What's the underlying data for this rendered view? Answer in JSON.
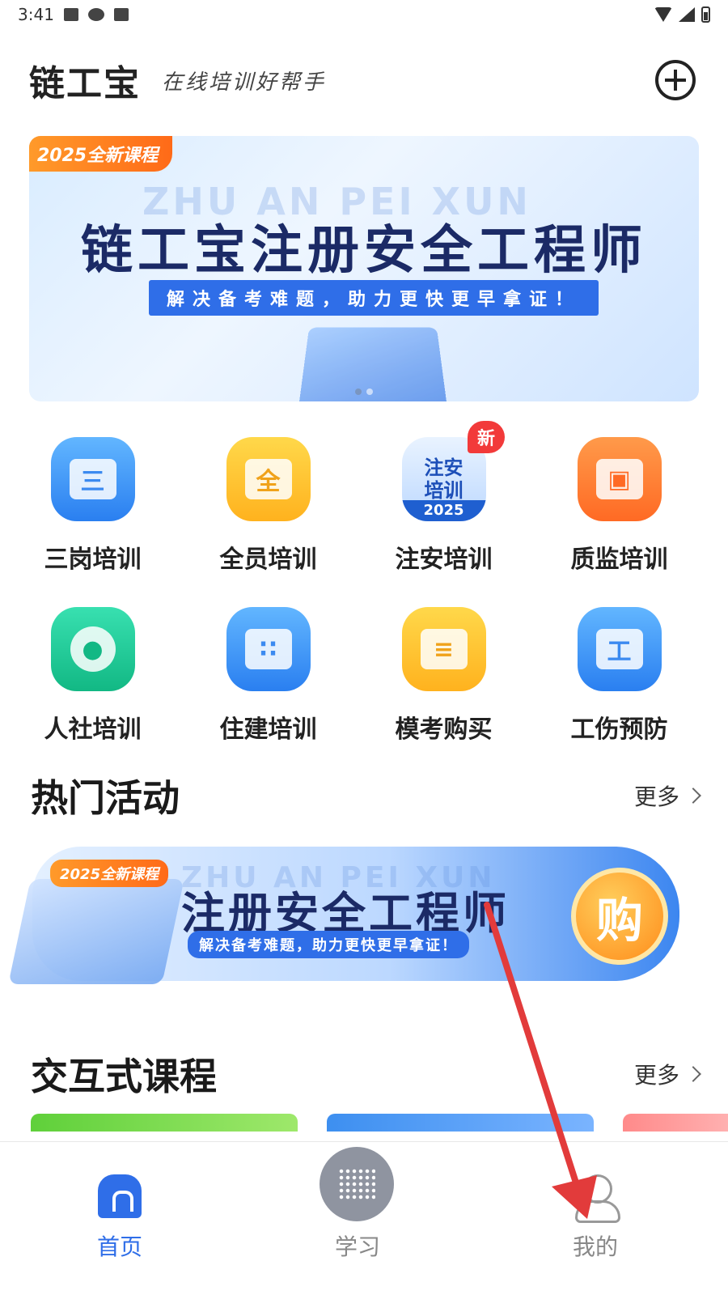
{
  "status_bar": {
    "time": "3:41"
  },
  "header": {
    "logo": "链工宝",
    "slogan": "在线培训好帮手"
  },
  "banner": {
    "tag": "2025全新课程",
    "bg_text": "ZHU AN PEI XUN",
    "title": "链工宝注册安全工程师",
    "subtitle": "解决备考难题，助力更快更早拿证！"
  },
  "categories": [
    {
      "label": "三岗培训",
      "icon": "三",
      "color": "blue"
    },
    {
      "label": "全员培训",
      "icon": "全",
      "color": "yellow"
    },
    {
      "label": "注安培训",
      "icon_lines": [
        "注安",
        "培训"
      ],
      "year": "2025",
      "badge": "新",
      "color": "zhuan"
    },
    {
      "label": "质监培训",
      "icon": "book-icon",
      "color": "orange"
    },
    {
      "label": "人社培训",
      "icon": "person-icon",
      "color": "green"
    },
    {
      "label": "住建培训",
      "icon": "building-icon",
      "color": "blue"
    },
    {
      "label": "模考购买",
      "icon": "bag-icon",
      "color": "yellow"
    },
    {
      "label": "工伤预防",
      "icon": "工",
      "color": "blue"
    }
  ],
  "hot_activities": {
    "title": "热门活动",
    "more": "更多",
    "promo": {
      "tag": "2025全新课程",
      "bg_text": "ZHU AN PEI XUN",
      "title": "注册安全工程师",
      "subtitle": "解决备考难题，助力更快更早拿证！",
      "buy_label": "购"
    }
  },
  "interactive_courses": {
    "title": "交互式课程",
    "more": "更多"
  },
  "tabbar": {
    "home": "首页",
    "study": "学习",
    "mine": "我的"
  },
  "colors": {
    "accent": "#2f6ee8",
    "annotation_arrow": "#e23b3b"
  }
}
